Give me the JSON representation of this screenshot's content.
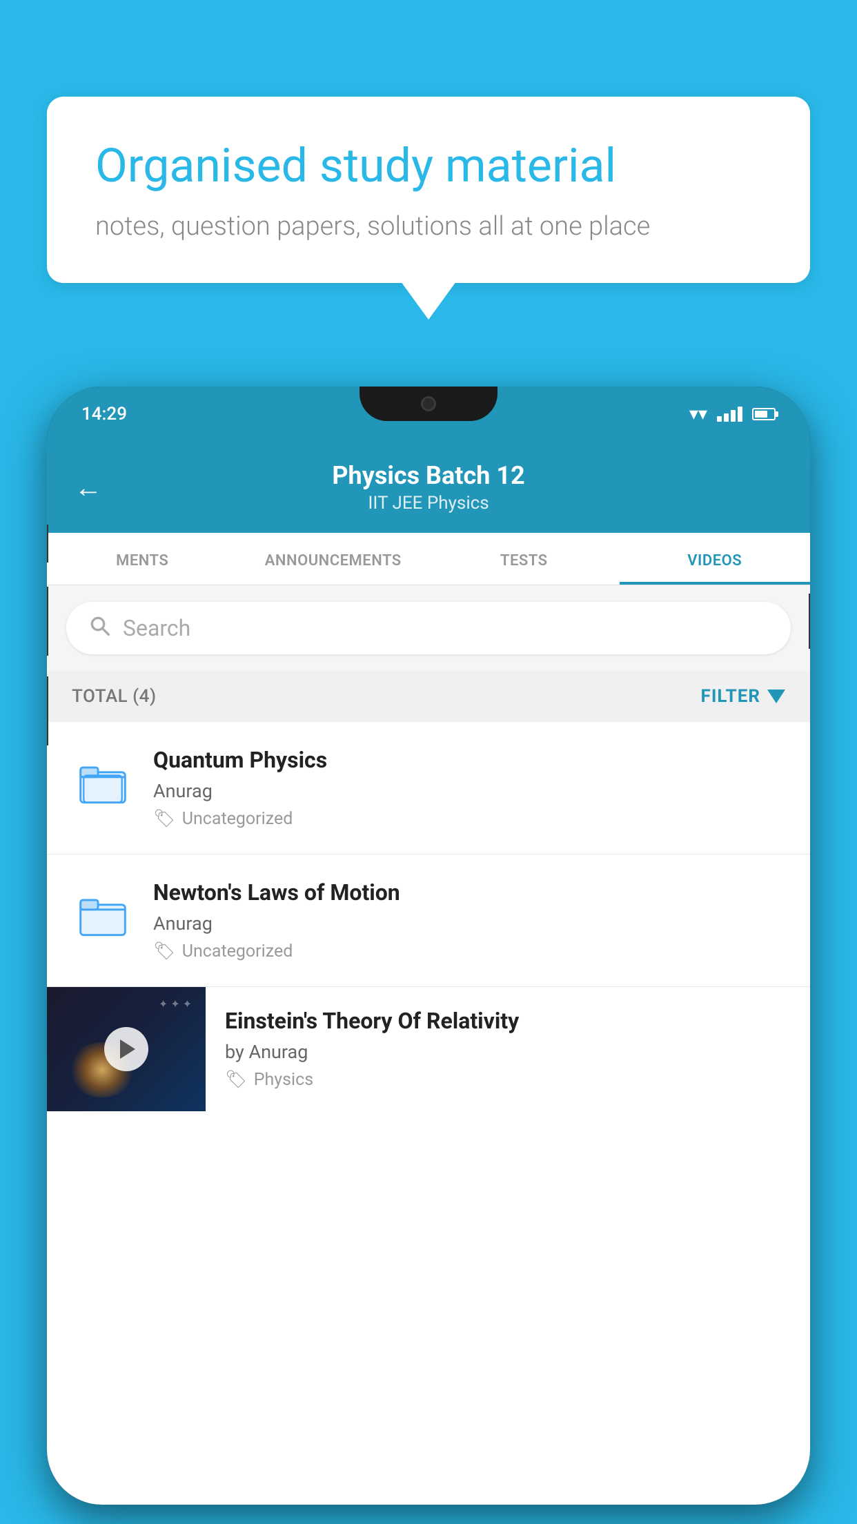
{
  "background_color": "#29b8e8",
  "speech_bubble": {
    "title": "Organised study material",
    "subtitle": "notes, question papers, solutions all at one place"
  },
  "phone": {
    "status_bar": {
      "time": "14:29"
    },
    "header": {
      "title": "Physics Batch 12",
      "subtitle": "IIT JEE   Physics",
      "back_label": "←"
    },
    "tabs": [
      {
        "label": "MENTS",
        "active": false
      },
      {
        "label": "ANNOUNCEMENTS",
        "active": false
      },
      {
        "label": "TESTS",
        "active": false
      },
      {
        "label": "VIDEOS",
        "active": true
      }
    ],
    "search": {
      "placeholder": "Search"
    },
    "filter_bar": {
      "total_label": "TOTAL (4)",
      "filter_label": "FILTER"
    },
    "videos": [
      {
        "title": "Quantum Physics",
        "author": "Anurag",
        "tag": "Uncategorized",
        "type": "folder"
      },
      {
        "title": "Newton's Laws of Motion",
        "author": "Anurag",
        "tag": "Uncategorized",
        "type": "folder"
      },
      {
        "title": "Einstein's Theory Of Relativity",
        "author": "by Anurag",
        "tag": "Physics",
        "type": "video"
      }
    ]
  }
}
